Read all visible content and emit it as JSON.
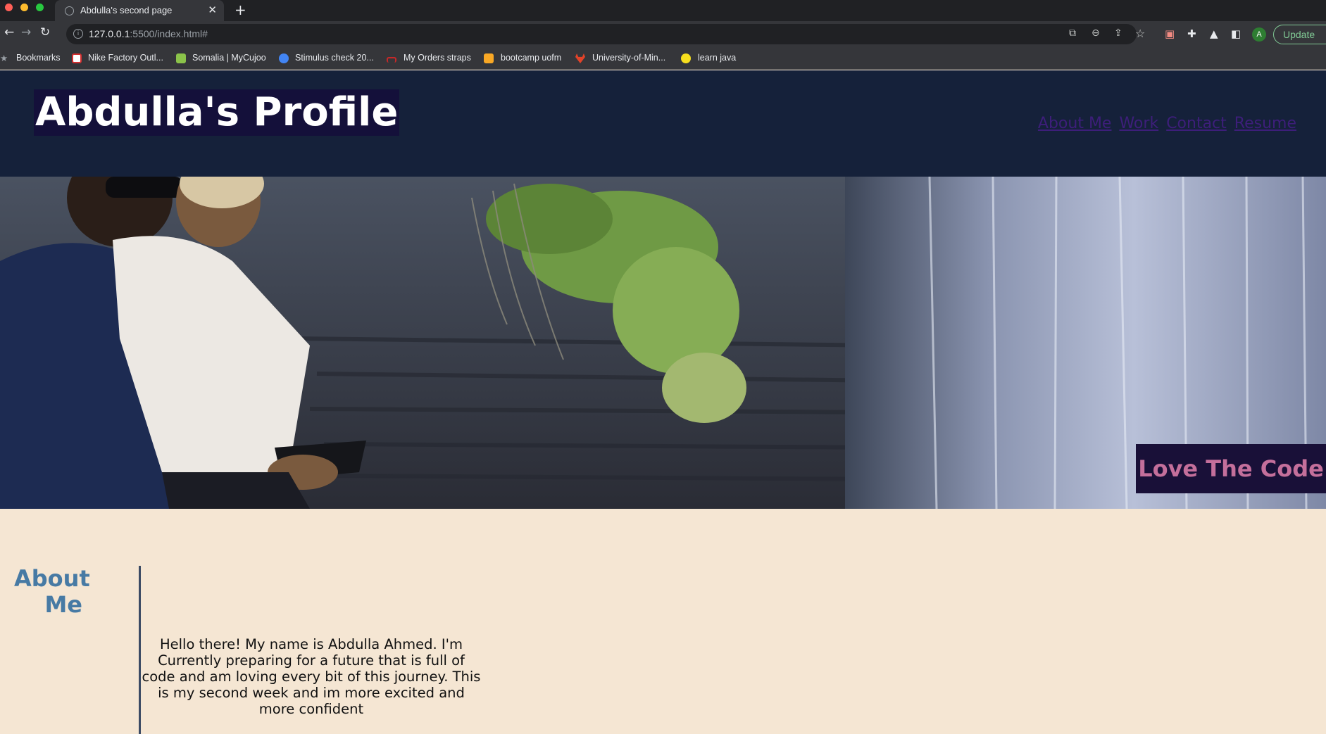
{
  "browser": {
    "tab_title": "Abdulla's second page",
    "tab_close": "✕",
    "new_tab": "+",
    "url_host": "127.0.0.1",
    "url_rest": ":5500/index.html#",
    "update_label": "Update",
    "avatar_letter": "A",
    "bookmarks": [
      {
        "label": "Bookmarks",
        "icon": "star-icon"
      },
      {
        "label": "Nike Factory Outl...",
        "icon": "nike-icon"
      },
      {
        "label": "Somalia | MyCujoo",
        "icon": "mycujoo-icon"
      },
      {
        "label": "Stimulus check 20...",
        "icon": "globe-icon"
      },
      {
        "label": "My Orders straps",
        "icon": "straps-icon"
      },
      {
        "label": "bootcamp uofm",
        "icon": "bootcamp-icon"
      },
      {
        "label": "University-of-Min...",
        "icon": "gitlab-icon"
      },
      {
        "label": "learn java",
        "icon": "js-icon"
      }
    ]
  },
  "header": {
    "title": "Abdulla's Profile",
    "nav": [
      "About Me",
      "Work",
      "Contact",
      "Resume"
    ]
  },
  "hero": {
    "badge": "Love The Code"
  },
  "about": {
    "title": "About Me",
    "text": "Hello there! My name is Abdulla Ahmed. I'm Currently preparing for a future that is full of code and am loving every bit of this journey. This is my second week and im more excited and more confident"
  },
  "colors": {
    "header_bg": "#15213a",
    "title_bg": "#14103a",
    "nav_link": "#3d1e7a",
    "badge_bg": "#191038",
    "badge_text": "#c46f9b",
    "section_title": "#477aa4",
    "content_bg": "#f5e6d3"
  }
}
